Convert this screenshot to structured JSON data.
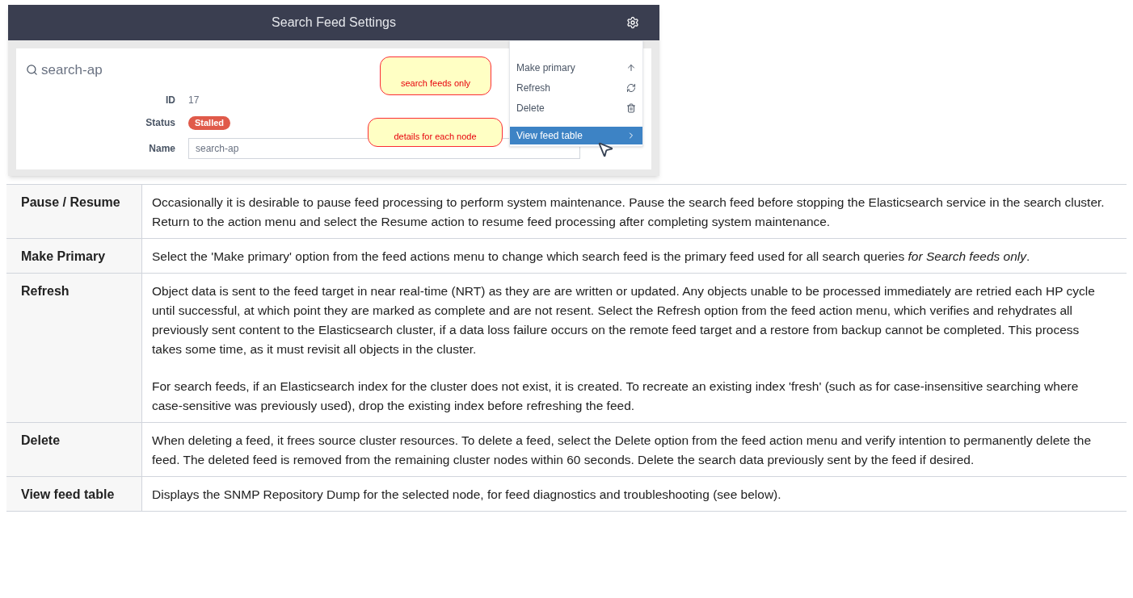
{
  "settings_screenshot": {
    "title": "Search Feed Settings",
    "search": "search-ap",
    "fields": [
      {
        "label": "ID",
        "value": "17",
        "kind": "text"
      },
      {
        "label": "Status",
        "value": "Stalled",
        "kind": "badge"
      },
      {
        "label": "Name",
        "value": "search-ap",
        "kind": "input"
      }
    ],
    "menu": [
      {
        "label": "Make primary",
        "selected": false
      },
      {
        "label": "Refresh",
        "selected": false
      },
      {
        "label": "Delete",
        "selected": false
      },
      {
        "label": "View feed table",
        "selected": true
      }
    ],
    "callouts": [
      "search feeds only",
      "details for each node"
    ]
  },
  "table": {
    "rows": [
      {
        "term": "Pause / Resume",
        "paragraphs": [
          "Occasionally it is desirable to pause feed processing to perform system maintenance. Pause the search feed before stopping the Elasticsearch service in the search cluster. Return to the action menu and select the Resume action to resume feed processing after completing system maintenance."
        ]
      },
      {
        "term": "Make Primary",
        "paragraphs": [
          "Select the 'Make primary' option from the feed actions menu to change which search feed is the primary feed used for all search queries *for Search feeds only*."
        ]
      },
      {
        "term": "Refresh",
        "paragraphs": [
          "Object data is sent to the feed target in near real-time (NRT) as they are are written or updated. Any objects unable to be processed immediately are retried each HP cycle until successful, at which point they are marked as complete and are not resent. Select the Refresh option from the feed action menu, which verifies and rehydrates all previously sent content to the Elasticsearch cluster, if a data loss failure occurs on the remote feed target and a restore from backup cannot be completed. This process takes some time, as it must revisit all objects in the cluster.",
          "For search feeds, if an Elasticsearch index for the cluster does not exist, it is created. To recreate an existing index 'fresh' (such as for case-insensitive searching where case-sensitive was previously used), drop the existing index before refreshing the feed."
        ]
      },
      {
        "term": "Delete",
        "paragraphs": [
          "When deleting a feed, it frees source cluster resources. To delete a feed, select the Delete option from the feed action menu and verify intention to permanently delete the feed. The deleted feed is removed from the remaining cluster nodes within 60 seconds. Delete the search data previously sent by the feed if desired."
        ]
      },
      {
        "term": "View feed table",
        "paragraphs": [
          "Displays the SNMP Repository Dump for the selected node, for feed diagnostics and troubleshooting (see below)."
        ]
      }
    ]
  }
}
